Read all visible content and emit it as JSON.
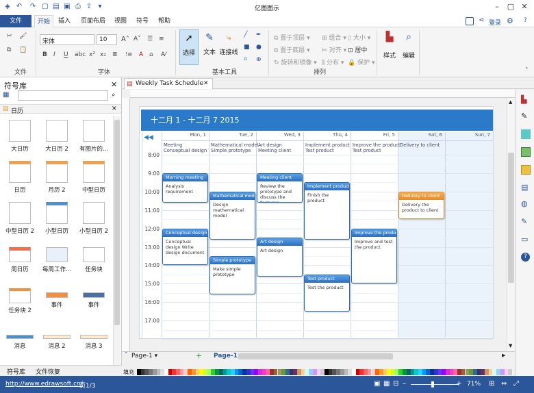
{
  "app": {
    "title": "亿图图示"
  },
  "tabs": [
    "文件",
    "开始",
    "插入",
    "页面布局",
    "视图",
    "符号",
    "帮助"
  ],
  "account": {
    "login": "登录"
  },
  "ribbon": {
    "font_name": "宋体",
    "font_size": "10",
    "groups": [
      "文件",
      "字体",
      "基本工具",
      "排列"
    ],
    "tools": {
      "select": "选择",
      "text": "文本",
      "connector": "连接线",
      "style": "样式",
      "edit": "编辑"
    },
    "arrange": {
      "front": "置于顶层",
      "back": "置于底层",
      "rotate": "旋转和镜像",
      "group": "组合",
      "align": "对齐",
      "distribute": "分布",
      "size": "大小",
      "center": "居中",
      "protect": "保护"
    }
  },
  "library": {
    "title": "符号库",
    "category": "日历",
    "items": [
      "大日历",
      "大日历 2",
      "有图片的...",
      "日历",
      "月历 2",
      "中型日历",
      "中型日历 2",
      "小型日历",
      "小型日历 2",
      "周日历",
      "每周工作...",
      "任务块",
      "任务块 2",
      "事件",
      "事件",
      "消息",
      "消息 2",
      "消息 3"
    ],
    "bottom_tabs": [
      "符号库",
      "文件恢复"
    ]
  },
  "document": {
    "tab_title": "Weekly Task Schedule"
  },
  "calendar": {
    "header": "十二月 1 - 十二月 7  2015",
    "days": [
      "Mon, 1",
      "Tue, 2",
      "Wed, 3",
      "Thu, 4",
      "Fri, 5",
      "Sat, 6",
      "Sun, 7"
    ],
    "times": [
      "8:00",
      "9:00",
      "10:00",
      "11:00",
      "12:00",
      "13:00",
      "14:00",
      "15:00",
      "16:00",
      "17:00"
    ],
    "all_day": [
      "Meeting\nConceptual design",
      "Mathematical model\nSimple prototype",
      "Art design\nMeeting client",
      "Implement product\nTest product",
      "Improve the product\nTest product",
      "Delivery to client",
      ""
    ],
    "events": [
      {
        "title": "Morning meeting",
        "body": "Analysis requirement"
      },
      {
        "title": "Mathematical model",
        "body": "Design mathematical model"
      },
      {
        "title": "Meeting client",
        "body": "Review the prototype and discuss the features"
      },
      {
        "title": "Implement product",
        "body": "Finish the product"
      },
      {
        "title": "Delivery to client",
        "body": "Delivery the product to client"
      },
      {
        "title": "Conceptual design",
        "body": "Conceptual design Write design document"
      },
      {
        "title": "Art design",
        "body": "Art design"
      },
      {
        "title": "Improve the product",
        "body": "Improve and test the product"
      },
      {
        "title": "Simple prototype",
        "body": "Make simple prototype"
      },
      {
        "title": "Test product",
        "body": "Test the product"
      }
    ]
  },
  "pages": {
    "tab1": "Page-1",
    "active": "Page-1"
  },
  "palette_label": "填充",
  "status": {
    "url": "http://www.edrawsoft.cn/",
    "page": "页1/3",
    "zoom": "71%"
  },
  "colors": {
    "brand": "#2b579a",
    "header": "#2a7ac9",
    "event_orange": "#e58a20"
  }
}
